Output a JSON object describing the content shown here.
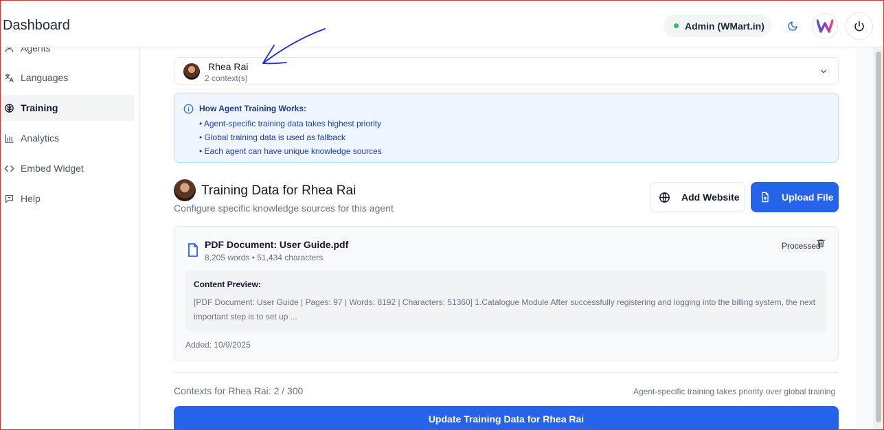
{
  "header": {
    "title": "Dashboard",
    "status_label": "Admin (WMart.in)",
    "status_color": "#22c55e",
    "icons": [
      "moon-icon",
      "wmart-logo",
      "power-icon"
    ]
  },
  "sidebar": {
    "items": [
      {
        "label": "Agents",
        "icon": "user-icon",
        "active": false
      },
      {
        "label": "Languages",
        "icon": "translate-icon",
        "active": false
      },
      {
        "label": "Training",
        "icon": "brain-icon",
        "active": true
      },
      {
        "label": "Analytics",
        "icon": "bar-chart-icon",
        "active": false
      },
      {
        "label": "Embed Widget",
        "icon": "code-icon",
        "active": false
      },
      {
        "label": "Help",
        "icon": "message-icon",
        "active": false
      }
    ]
  },
  "agent_select": {
    "name": "Rhea Rai",
    "contexts": "2 context(s)"
  },
  "info": {
    "title": "How Agent Training Works:",
    "bullets": [
      "• Agent-specific training data takes highest priority",
      "• Global training data is used as fallback",
      "• Each agent can have unique knowledge sources"
    ]
  },
  "training": {
    "title": "Training Data for Rhea Rai",
    "subtitle": "Configure specific knowledge sources for this agent",
    "add_website_label": "Add Website",
    "upload_label": "Upload File"
  },
  "document": {
    "title": "PDF Document: User Guide.pdf",
    "meta": "8,205 words • 51,434 characters",
    "status": "Processed",
    "preview_label": "Content Preview:",
    "preview_text": "[PDF Document: User Guide | Pages: 97 | Words: 8192 | Characters: 51360] 1.Catalogue Module After successfully registering and logging into the billing system, the next important step is to set up ...",
    "added": "Added: 10/9/2025"
  },
  "footer": {
    "context_count": "Contexts for Rhea Rai: 2 / 300",
    "priority_note": "Agent-specific training takes priority over global training",
    "update_label": "Update Training Data for Rhea Rai"
  },
  "colors": {
    "accent": "#2563eb",
    "info_bg": "#eff6ff",
    "annotation": "#1d2bd6"
  }
}
